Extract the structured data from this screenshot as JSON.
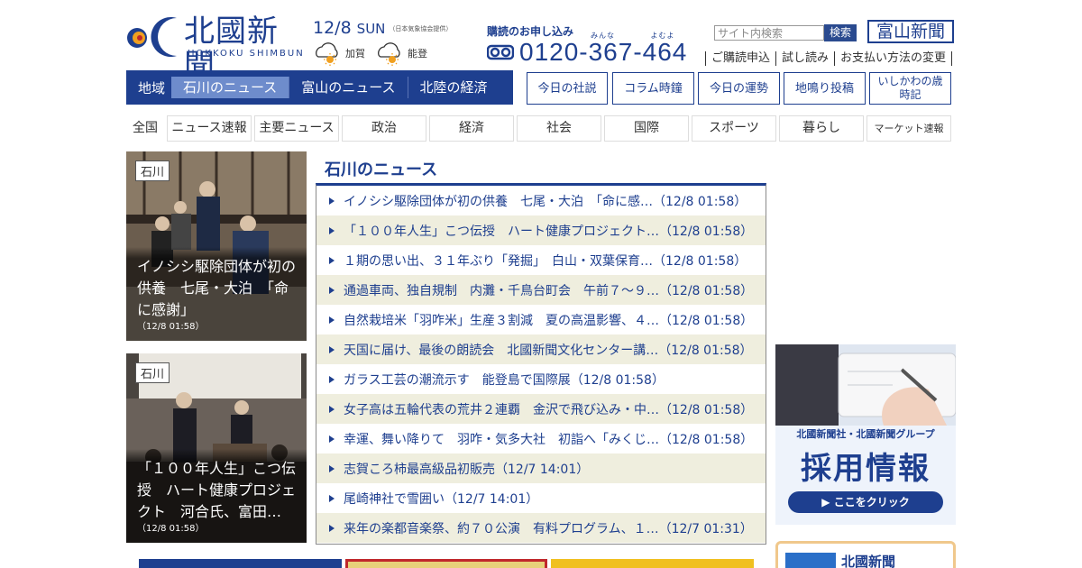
{
  "brand": {
    "name": "北國新聞",
    "name_romaji": "HOKKOKU SHIMBUN",
    "color": "#1e3f8f"
  },
  "date": {
    "date": "12/8",
    "weekday": "SUN",
    "weather_source": "（日本気象協会提供）"
  },
  "weather": [
    {
      "area": "加賀",
      "icon": "sunny-cloudy-icon"
    },
    {
      "area": "能登",
      "icon": "sunny-cloudy-icon"
    }
  ],
  "subscription": {
    "title": "購読のお申し込み",
    "ruby": "みんな よむよ",
    "phone": "0120-367-464",
    "icon": "freedial-icon"
  },
  "search": {
    "placeholder": "サイト内検索",
    "button": "検索"
  },
  "toyama_link": "富山新聞",
  "sub_links": [
    "ご購読申込",
    "試し読み",
    "お支払い方法の変更"
  ],
  "region_nav": {
    "label": "地域",
    "tabs": [
      "石川のニュース",
      "富山のニュース",
      "北陸の経済"
    ],
    "active": 0
  },
  "feature_buttons": [
    "今日の社説",
    "コラム時鐘",
    "今日の運勢",
    "地鳴り投稿",
    "いしかわの歳時記"
  ],
  "categories": {
    "all": "全国",
    "items": [
      "ニュース速報",
      "主要ニュース",
      "政治",
      "経済",
      "社会",
      "国際",
      "スポーツ",
      "暮らし",
      "マーケット速報"
    ]
  },
  "feature_cards": [
    {
      "badge": "石川",
      "caption": "イノシシ駆除団体が初の供養　七尾・大泊　「命に感謝」",
      "time": "（12/8 01:58）"
    },
    {
      "badge": "石川",
      "caption": "「１００年人生」こつ伝授　ハート健康プロジェクト　河合氏、富田…",
      "time": "（12/8 01:58）"
    }
  ],
  "news": {
    "title": "石川のニュース",
    "items": [
      "イノシシ駆除団体が初の供養　七尾・大泊　「命に感…（12/8 01:58）",
      "「１００年人生」こつ伝授　ハート健康プロジェクト…（12/8 01:58）",
      "１期の思い出、３１年ぶり「発掘」　白山・双葉保育…（12/8 01:58）",
      "通過車両、独自規制　内灘・千鳥台町会　午前７～９…（12/8 01:58）",
      "自然栽培米「羽咋米」生産３割減　夏の高温影響、４…（12/8 01:58）",
      "天国に届け、最後の朗読会　北國新聞文化センター講…（12/8 01:58）",
      "ガラス工芸の潮流示す　能登島で国際展（12/8 01:58）",
      "女子高は五輪代表の荒井２連覇　金沢で飛び込み・中…（12/8 01:58）",
      "幸運、舞い降りて　羽咋・気多大社　初詣へ「みくじ…（12/8 01:58）",
      "志賀ころ柿最高級品初販売（12/7 14:01）",
      "尾崎神社で雪囲い（12/7 14:01）",
      "来年の楽都音楽祭、約７０公演　有料プログラム、１…（12/7 01:31）"
    ]
  },
  "recruit_ad": {
    "org": "北國新聞社・北國新聞グループ",
    "title": "採用情報",
    "cta": "▶ ここをクリック"
  },
  "bottom_ad": {
    "label": "北國新聞"
  }
}
